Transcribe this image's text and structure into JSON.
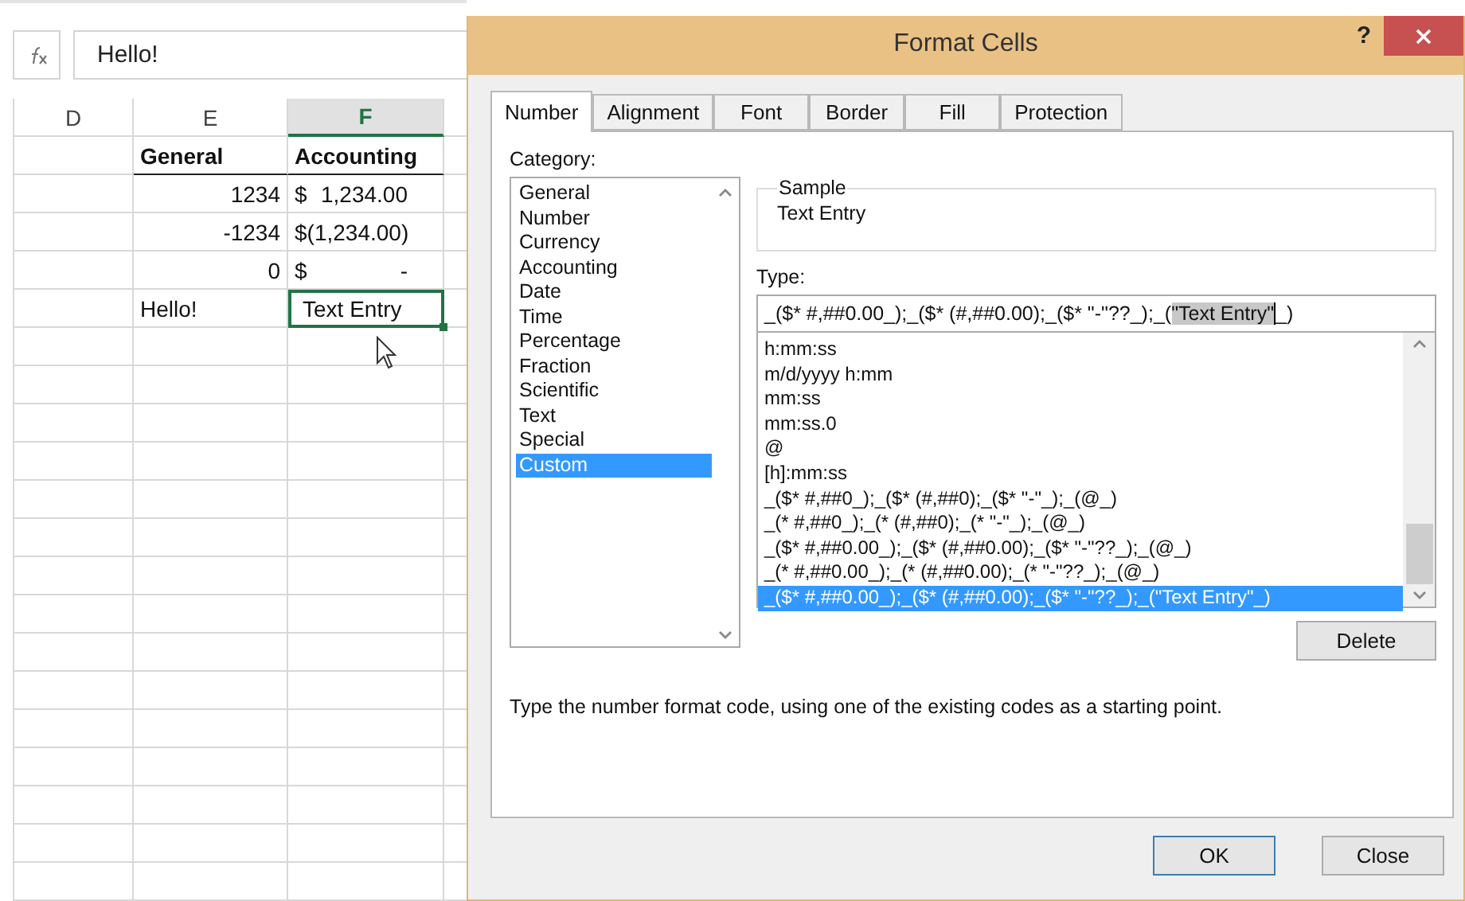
{
  "formula_bar": {
    "value": "Hello!"
  },
  "sheet": {
    "columns": [
      {
        "label": "D",
        "selected": false
      },
      {
        "label": "E",
        "selected": false
      },
      {
        "label": "F",
        "selected": true
      }
    ],
    "rows": [
      {
        "cells": [
          {
            "kind": "header",
            "text": "General",
            "selected": false
          },
          {
            "kind": "header",
            "text": "Accounting",
            "selected": false
          }
        ]
      },
      {
        "cells": [
          {
            "kind": "number",
            "text": "1234",
            "selected": false
          },
          {
            "kind": "accounting",
            "symbol": "$",
            "amount": "1,234.00",
            "selected": false
          }
        ]
      },
      {
        "cells": [
          {
            "kind": "number",
            "text": "-1234",
            "selected": false
          },
          {
            "kind": "accounting",
            "symbol": "$",
            "amount": "(1,234.00)",
            "selected": false
          }
        ]
      },
      {
        "cells": [
          {
            "kind": "number",
            "text": "0",
            "selected": false
          },
          {
            "kind": "accounting",
            "symbol": "$",
            "amount": "-",
            "selected": false
          }
        ]
      },
      {
        "cells": [
          {
            "kind": "text",
            "text": "Hello!",
            "selected": false
          },
          {
            "kind": "text",
            "text": "Text Entry",
            "selected": true
          }
        ]
      }
    ]
  },
  "dialog": {
    "title": "Format Cells",
    "help": "?",
    "tabs": [
      {
        "label": "Number",
        "selected": true
      },
      {
        "label": "Alignment",
        "selected": false
      },
      {
        "label": "Font",
        "selected": false
      },
      {
        "label": "Border",
        "selected": false
      },
      {
        "label": "Fill",
        "selected": false
      },
      {
        "label": "Protection",
        "selected": false
      }
    ],
    "category": {
      "label": "Category:",
      "items": [
        {
          "label": "General",
          "selected": false
        },
        {
          "label": "Number",
          "selected": false
        },
        {
          "label": "Currency",
          "selected": false
        },
        {
          "label": "Accounting",
          "selected": false
        },
        {
          "label": "Date",
          "selected": false
        },
        {
          "label": "Time",
          "selected": false
        },
        {
          "label": "Percentage",
          "selected": false
        },
        {
          "label": "Fraction",
          "selected": false
        },
        {
          "label": "Scientific",
          "selected": false
        },
        {
          "label": "Text",
          "selected": false
        },
        {
          "label": "Special",
          "selected": false
        },
        {
          "label": "Custom",
          "selected": true
        }
      ]
    },
    "sample": {
      "label": "Sample",
      "value": "Text Entry"
    },
    "type": {
      "label": "Type:",
      "value_parts": [
        {
          "text": "_($* #,##0.00_);_($* (#,##0.00);_($* \"-\"??_);_(",
          "selected": false
        },
        {
          "text": "\"Text Entry\"",
          "selected": true
        },
        {
          "text": "_)",
          "selected": false
        }
      ]
    },
    "formats": [
      {
        "label": "h:mm:ss",
        "selected": false
      },
      {
        "label": "m/d/yyyy h:mm",
        "selected": false
      },
      {
        "label": "mm:ss",
        "selected": false
      },
      {
        "label": "mm:ss.0",
        "selected": false
      },
      {
        "label": "@",
        "selected": false
      },
      {
        "label": "[h]:mm:ss",
        "selected": false
      },
      {
        "label": "_($* #,##0_);_($* (#,##0);_($* \"-\"_);_(@_)",
        "selected": false
      },
      {
        "label": "_(* #,##0_);_(* (#,##0);_(* \"-\"_);_(@_)",
        "selected": false
      },
      {
        "label": "_($* #,##0.00_);_($* (#,##0.00);_($* \"-\"??_);_(@_)",
        "selected": false
      },
      {
        "label": "_(* #,##0.00_);_(* (#,##0.00);_(* \"-\"??_);_(@_)",
        "selected": false
      },
      {
        "label": "_($* #,##0.00_);_($* (#,##0.00);_($* \"-\"??_);_(\"Text Entry\"_)",
        "selected": true
      }
    ],
    "delete": "Delete",
    "hint": "Type the number format code, using one of the existing codes as a starting point.",
    "buttons": [
      {
        "label": "OK",
        "kind": "default"
      },
      {
        "label": "Close",
        "kind": "normal"
      }
    ]
  }
}
